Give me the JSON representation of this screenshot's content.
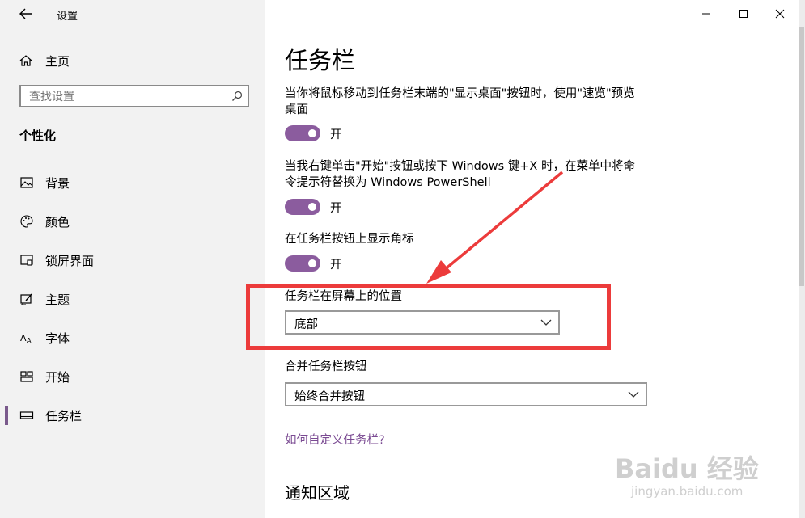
{
  "window": {
    "title": "设置"
  },
  "sidebar": {
    "home_label": "主页",
    "search": {
      "placeholder": "查找设置"
    },
    "section_title": "个性化",
    "items": [
      {
        "label": "背景",
        "icon": "image-icon"
      },
      {
        "label": "颜色",
        "icon": "palette-icon"
      },
      {
        "label": "锁屏界面",
        "icon": "lock-screen-icon"
      },
      {
        "label": "主题",
        "icon": "theme-icon"
      },
      {
        "label": "字体",
        "icon": "font-icon"
      },
      {
        "label": "开始",
        "icon": "start-icon"
      },
      {
        "label": "任务栏",
        "icon": "taskbar-icon",
        "active": true
      }
    ]
  },
  "main": {
    "heading": "任务栏",
    "settings": [
      {
        "description": "当你将鼠标移动到任务栏末端的\"显示桌面\"按钮时，使用\"速览\"预览桌面",
        "state": "开",
        "on": true
      },
      {
        "description": "当我右键单击\"开始\"按钮或按下 Windows 键+X 时，在菜单中将命令提示符替换为 Windows PowerShell",
        "state": "开",
        "on": true
      },
      {
        "description": "在任务栏按钮上显示角标",
        "state": "开",
        "on": true
      }
    ],
    "position": {
      "label": "任务栏在屏幕上的位置",
      "value": "底部"
    },
    "combine": {
      "label": "合并任务栏按钮",
      "value": "始终合并按钮"
    },
    "help_link": "如何自定义任务栏?",
    "notification_heading": "通知区域"
  },
  "watermark": {
    "brand": "Baidu 经验",
    "sub": "jingyan.baidu.com"
  },
  "colors": {
    "accent": "#8b5c9e",
    "link": "#7a4a92",
    "highlight": "#ec3b3b",
    "sidebar_bg": "#f2f2f2"
  }
}
